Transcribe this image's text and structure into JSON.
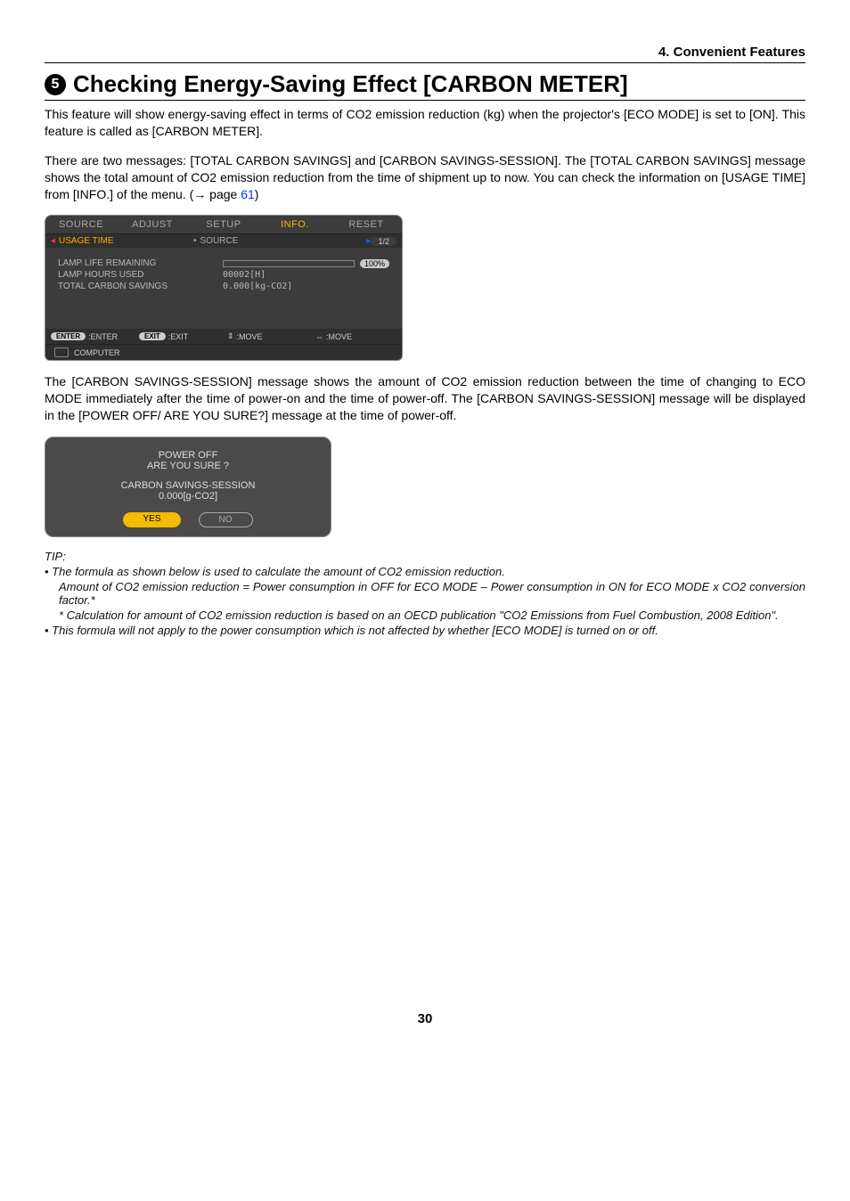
{
  "header": {
    "section_label": "4. Convenient Features"
  },
  "title": {
    "number": "5",
    "text": "Checking Energy-Saving Effect [CARBON METER]"
  },
  "para1": "This feature will show energy-saving effect in terms of CO2 emission reduction (kg) when the projector's [ECO MODE] is set to [ON]. This feature is called as [CARBON METER].",
  "para2_pre": "There are two messages: [TOTAL CARBON SAVINGS] and [CARBON SAVINGS-SESSION]. The [TOTAL CARBON SAVINGS] message shows the total amount of CO2 emission reduction from the time of shipment up to now. You can check the information on [USAGE TIME] from [INFO.] of the menu. (→ page ",
  "para2_link": "61",
  "para2_post": ")",
  "osd": {
    "tabs": [
      "SOURCE",
      "ADJUST",
      "SETUP",
      "INFO.",
      "RESET"
    ],
    "sub_left": "USAGE TIME",
    "sub_mid_bullet": "•",
    "sub_mid": "SOURCE",
    "page_indicator": "1/2",
    "rows": {
      "lamp_life_label": "LAMP LIFE REMAINING",
      "lamp_life_badge": "100%",
      "lamp_hours_label": "LAMP HOURS USED",
      "lamp_hours_value": "00002[H]",
      "carbon_label": "TOTAL CARBON SAVINGS",
      "carbon_value": "0.000[kg-CO2]"
    },
    "footer": {
      "enter_pill": "ENTER",
      "enter_label": ":ENTER",
      "exit_pill": "EXIT",
      "exit_label": ":EXIT",
      "updown_symbol": "⇕",
      "move_label_1": ":MOVE",
      "leftright_symbol": "⇔",
      "move_label_2": ":MOVE",
      "source_label": "COMPUTER"
    }
  },
  "para3": "The [CARBON SAVINGS-SESSION] message shows the amount of CO2 emission reduction between the time of changing to ECO MODE immediately after the time of power-on and the time of power-off. The [CARBON SAVINGS-SESSION] message will be displayed in the [POWER OFF/ ARE YOU SURE?] message at the time of power-off.",
  "dialog": {
    "line1": "POWER OFF",
    "line2": "ARE YOU SURE ?",
    "line3": "CARBON SAVINGS-SESSION",
    "line4": "0.000[g-CO2]",
    "yes": "YES",
    "no": "NO"
  },
  "tip": {
    "heading": "TIP:",
    "bullet1": "The formula as shown below is used to calculate the amount of CO2 emission reduction.",
    "line2": "Amount of CO2 emission reduction = Power consumption in OFF for ECO MODE – Power consumption in ON for ECO MODE x CO2 conversion factor.*",
    "star": "* Calculation for amount of CO2 emission reduction is based on an OECD publication \"CO2 Emissions from Fuel Combustion, 2008 Edition\".",
    "bullet2": "This formula will not apply to the power consumption which is not affected by whether [ECO MODE] is turned on or off."
  },
  "page_number": "30"
}
